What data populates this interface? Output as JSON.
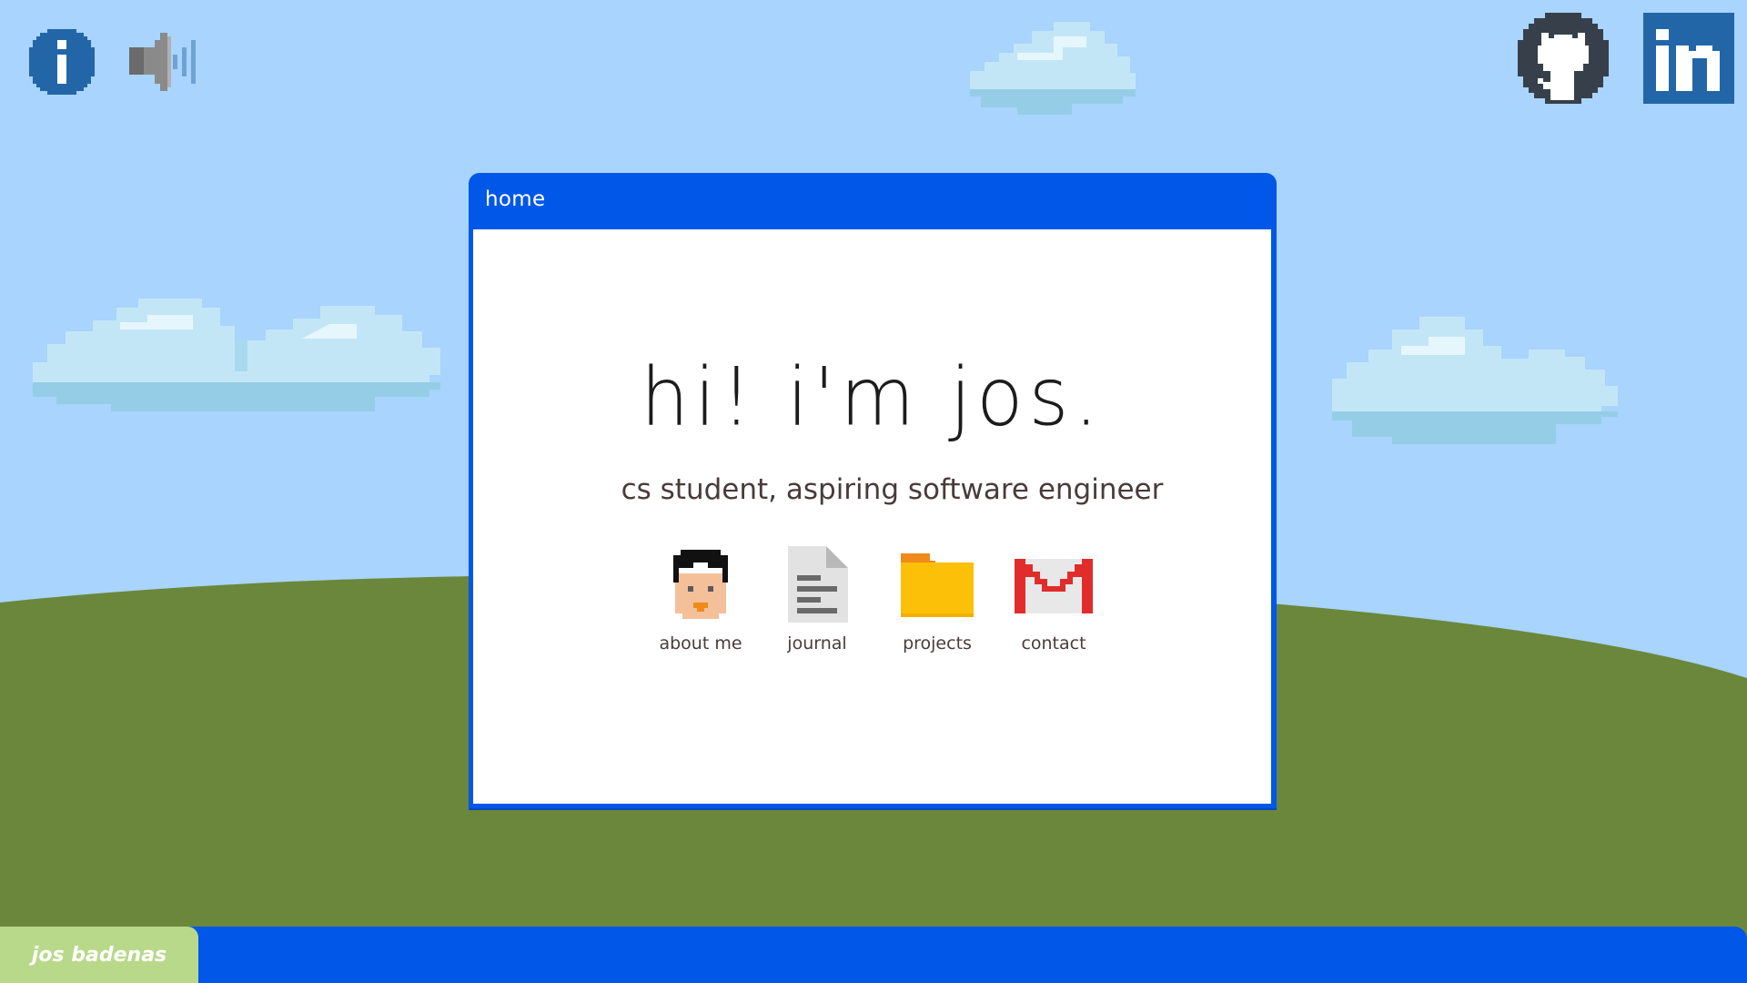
{
  "window": {
    "title": "home"
  },
  "hero": {
    "greeting": "hi! i'm jos.",
    "subtitle": "cs student, aspiring software engineer"
  },
  "apps": [
    {
      "label": "about me",
      "icon": "avatar-icon"
    },
    {
      "label": "journal",
      "icon": "document-icon"
    },
    {
      "label": "projects",
      "icon": "folder-icon"
    },
    {
      "label": "contact",
      "icon": "gmail-icon"
    }
  ],
  "taskbar": {
    "start_label": "jos badenas"
  },
  "top_left_icons": [
    "info-icon",
    "speaker-icon"
  ],
  "top_right_icons": [
    "github-icon",
    "linkedin-icon"
  ],
  "colors": {
    "sky": "#a8d4fd",
    "hill": "#6b873b",
    "window_accent": "#0057e8",
    "start_button": "#b8d98a"
  }
}
